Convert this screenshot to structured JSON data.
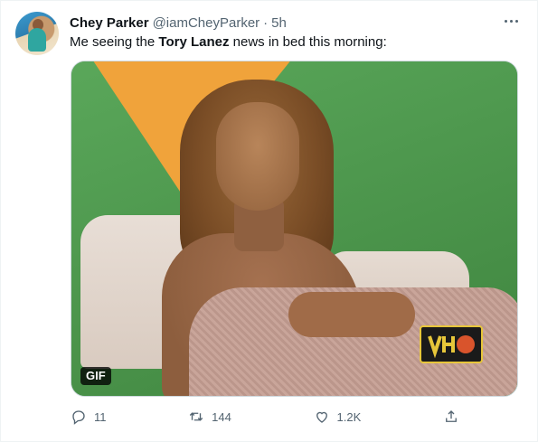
{
  "tweet": {
    "display_name": "Chey Parker",
    "handle": "@iamCheyParker",
    "separator": "·",
    "time": "5h",
    "text_prefix": "Me seeing the ",
    "text_bold": "Tory Lanez",
    "text_suffix": " news in bed this morning:"
  },
  "media": {
    "badge": "GIF"
  },
  "actions": {
    "reply_count": "11",
    "retweet_count": "144",
    "like_count": "1.2K"
  },
  "colors": {
    "text_secondary": "#536471",
    "border": "#eff3f4"
  },
  "icons": [
    "more-icon",
    "reply-icon",
    "retweet-icon",
    "like-icon",
    "share-icon"
  ]
}
